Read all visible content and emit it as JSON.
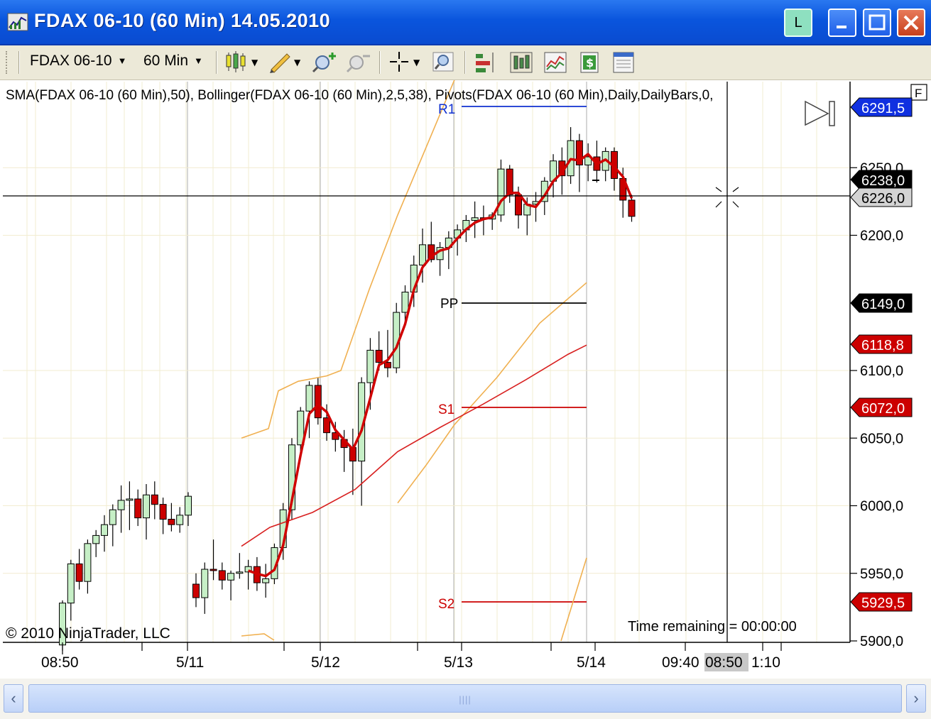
{
  "window": {
    "title": "FDAX 06-10 (60 Min)  14.05.2010",
    "link_button": "L"
  },
  "toolbar": {
    "instrument": "FDAX 06-10",
    "interval": "60 Min",
    "icons": [
      "candlestick-chart-icon",
      "pencil-draw-icon",
      "zoom-in-icon",
      "zoom-out-icon",
      "crosshair-icon",
      "magnifier-icon",
      "bar-spacing-icon",
      "data-box-icon",
      "chart-properties-icon",
      "strategy-icon",
      "indicator-panel-icon"
    ]
  },
  "chart": {
    "indicator_label": "SMA(FDAX 06-10 (60 Min),50), Bollinger(FDAX 06-10 (60 Min),2,5,38), Pivots(FDAX 06-10 (60 Min),Daily,DailyBars,0,",
    "flag_label": "F",
    "copyright": "© 2010 NinjaTrader, LLC",
    "time_remaining": "Time remaining = 00:00:00",
    "price_ticks": [
      "6250,0",
      "6200,0",
      "6100,0",
      "6050,0",
      "6000,0",
      "5950,0",
      "5900,0"
    ],
    "time_ticks": [
      "08:50",
      "5/11",
      "5/12",
      "5/13",
      "5/14",
      "09:40",
      "1:10"
    ],
    "cursor_time": "08:50",
    "pivot_labels": {
      "r1": "R1",
      "pp": "PP",
      "s1": "S1",
      "s2": "S2"
    },
    "price_tags": {
      "r1": "6291,5",
      "last_price": "6238,0",
      "cursor_price": "6226,0",
      "pp": "6149,0",
      "sma": "6118,8",
      "s1": "6072,0",
      "s2": "5929,5"
    },
    "colors": {
      "up_candle": "#c6efc6",
      "down_candle": "#cc0000",
      "sma": "#d82020",
      "sma_overlay": "#e03030",
      "bollinger": "#f0b050",
      "r1": "#0000cc",
      "pp": "#000000",
      "s1": "#cc0000",
      "s2": "#cc0000"
    }
  },
  "chart_data": {
    "type": "candlestick",
    "instrument": "FDAX 06-10",
    "interval": "60 Min",
    "y_range": [
      5900,
      6300
    ],
    "pivots": {
      "R1": 6291.5,
      "PP": 6149.0,
      "S1": 6072.0,
      "S2": 5929.5
    },
    "last_price": 6238.0,
    "cursor_price": 6226.0,
    "sma_last": 6118.8,
    "candles_ohlc": [
      [
        5897,
        5930,
        5890,
        5928
      ],
      [
        5928,
        5960,
        5915,
        5957
      ],
      [
        5957,
        5968,
        5938,
        5944
      ],
      [
        5944,
        5975,
        5935,
        5972
      ],
      [
        5972,
        5982,
        5962,
        5978
      ],
      [
        5978,
        5993,
        5966,
        5986
      ],
      [
        5986,
        6001,
        5970,
        5997
      ],
      [
        5997,
        6015,
        5980,
        6004
      ],
      [
        6004,
        6018,
        5982,
        6005
      ],
      [
        6005,
        6012,
        5985,
        5991
      ],
      [
        5991,
        6016,
        5975,
        6008
      ],
      [
        6008,
        6018,
        5990,
        6001
      ],
      [
        6001,
        6006,
        5979,
        5990
      ],
      [
        5990,
        6002,
        5981,
        5986
      ],
      [
        5986,
        5999,
        5980,
        5993
      ],
      [
        5993,
        6010,
        5985,
        6007
      ],
      [
        5942,
        5950,
        5925,
        5932
      ],
      [
        5932,
        5958,
        5920,
        5953
      ],
      [
        5953,
        5975,
        5945,
        5952
      ],
      [
        5952,
        5958,
        5938,
        5945
      ],
      [
        5945,
        5952,
        5930,
        5950
      ],
      [
        5950,
        5965,
        5946,
        5951
      ],
      [
        5951,
        5960,
        5938,
        5955
      ],
      [
        5955,
        5962,
        5937,
        5943
      ],
      [
        5943,
        5957,
        5932,
        5946
      ],
      [
        5946,
        5972,
        5942,
        5969
      ],
      [
        5969,
        6002,
        5960,
        5997
      ],
      [
        5997,
        6050,
        5990,
        6045
      ],
      [
        6045,
        6073,
        6035,
        6070
      ],
      [
        6070,
        6092,
        6050,
        6089
      ],
      [
        6089,
        6095,
        6060,
        6065
      ],
      [
        6065,
        6075,
        6048,
        6054
      ],
      [
        6054,
        6062,
        6040,
        6049
      ],
      [
        6049,
        6056,
        6025,
        6043
      ],
      [
        6043,
        6057,
        6008,
        6033
      ],
      [
        6033,
        6095,
        6000,
        6091
      ],
      [
        6091,
        6124,
        6071,
        6115
      ],
      [
        6115,
        6129,
        6100,
        6106
      ],
      [
        6106,
        6130,
        6095,
        6102
      ],
      [
        6102,
        6150,
        6098,
        6143
      ],
      [
        6143,
        6163,
        6133,
        6158
      ],
      [
        6158,
        6185,
        6147,
        6178
      ],
      [
        6178,
        6205,
        6165,
        6193
      ],
      [
        6193,
        6210,
        6180,
        6182
      ],
      [
        6182,
        6195,
        6170,
        6191
      ],
      [
        6191,
        6203,
        6175,
        6198
      ],
      [
        6198,
        6208,
        6185,
        6204
      ],
      [
        6204,
        6215,
        6195,
        6211
      ],
      [
        6211,
        6225,
        6198,
        6213
      ],
      [
        6213,
        6222,
        6200,
        6212
      ],
      [
        6212,
        6217,
        6204,
        6215
      ],
      [
        6215,
        6256,
        6210,
        6249
      ],
      [
        6249,
        6252,
        6224,
        6230
      ],
      [
        6230,
        6236,
        6205,
        6215
      ],
      [
        6215,
        6228,
        6200,
        6223
      ],
      [
        6223,
        6232,
        6210,
        6225
      ],
      [
        6225,
        6243,
        6215,
        6240
      ],
      [
        6240,
        6260,
        6228,
        6255
      ],
      [
        6255,
        6265,
        6230,
        6244
      ],
      [
        6244,
        6280,
        6238,
        6270
      ],
      [
        6270,
        6275,
        6232,
        6252
      ],
      [
        6252,
        6268,
        6240,
        6258
      ],
      [
        6258,
        6270,
        6239,
        6248
      ],
      [
        6248,
        6265,
        6240,
        6262
      ],
      [
        6262,
        6265,
        6233,
        6242
      ],
      [
        6242,
        6250,
        6213,
        6226
      ],
      [
        6226,
        6230,
        6210,
        6214
      ]
    ]
  }
}
